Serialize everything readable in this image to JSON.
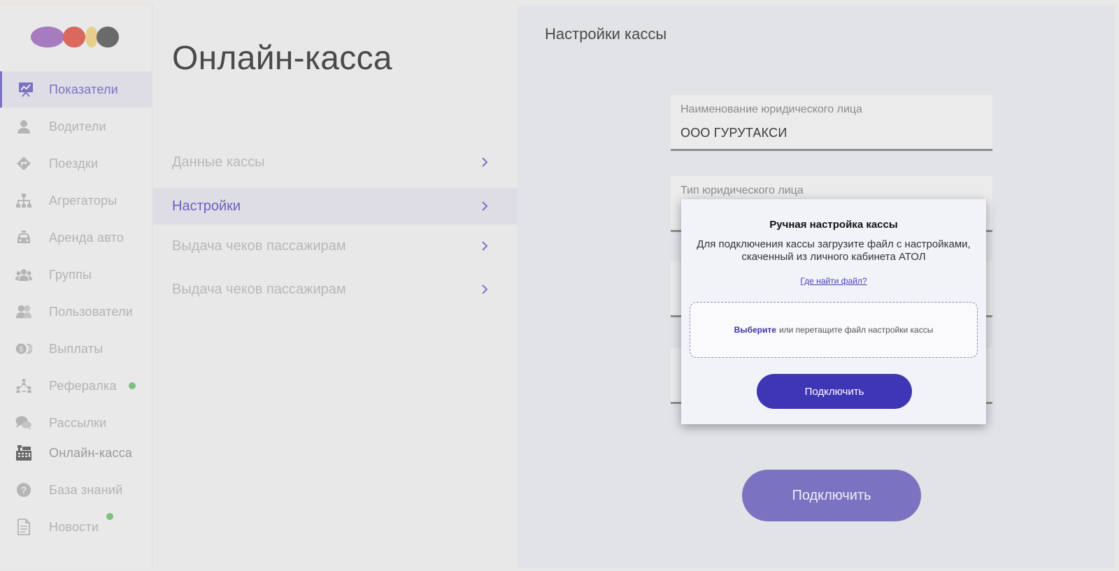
{
  "colors": {
    "accent": "#7a72c4",
    "accent_dark": "#3f36b5",
    "notification_dot": "#7fbf7f"
  },
  "sidebar": {
    "logo": "brand-logo",
    "items": [
      {
        "label": "Показатели",
        "icon": "presentation-chart-icon",
        "state": "active"
      },
      {
        "label": "Водители",
        "icon": "user-icon"
      },
      {
        "label": "Поездки",
        "icon": "route-sign-icon"
      },
      {
        "label": "Агрегаторы",
        "icon": "hierarchy-icon"
      },
      {
        "label": "Аренда авто",
        "icon": "taxi-car-icon"
      },
      {
        "label": "Группы",
        "icon": "group-icon"
      },
      {
        "label": "Пользователи",
        "icon": "users-icon"
      },
      {
        "label": "Выплаты",
        "icon": "coins-icon"
      },
      {
        "label": "Рефералка",
        "icon": "referral-icon",
        "badge": "notification-dot"
      },
      {
        "label": "Рассылки",
        "icon": "chat-bubbles-icon"
      },
      {
        "label": "Онлайн-касса",
        "icon": "cash-register-icon"
      },
      {
        "label": "База знаний",
        "icon": "help-circle-icon"
      },
      {
        "label": "Новости",
        "icon": "document-icon",
        "badge": "notification-dot"
      }
    ]
  },
  "main": {
    "title": "Онлайн-касса",
    "menu": [
      {
        "label": "Данные кассы"
      },
      {
        "label": "Настройки",
        "state": "active"
      },
      {
        "label": "Выдача чеков пассажирам"
      },
      {
        "label": "Выдача чеков пассажирам"
      }
    ]
  },
  "panel": {
    "title": "Настройки кассы",
    "fields": [
      {
        "label": "Наименование юридического лица",
        "value": "ООО ГУРУТАКСИ"
      },
      {
        "label": "Тип юридического лица",
        "value": ""
      },
      {
        "label": "",
        "value": ""
      },
      {
        "label": "",
        "value": ""
      }
    ],
    "connect_button": "Подключить"
  },
  "modal": {
    "title": "Ручная настройка кассы",
    "description": "Для подключения кассы загрузите файл с настройками, скаченный из личного кабинета АТОЛ",
    "help_link": "Где найти файл?",
    "dropzone_action": "Выберите",
    "dropzone_text": "или перетащите файл настройки кассы",
    "submit_button": "Подключить"
  }
}
